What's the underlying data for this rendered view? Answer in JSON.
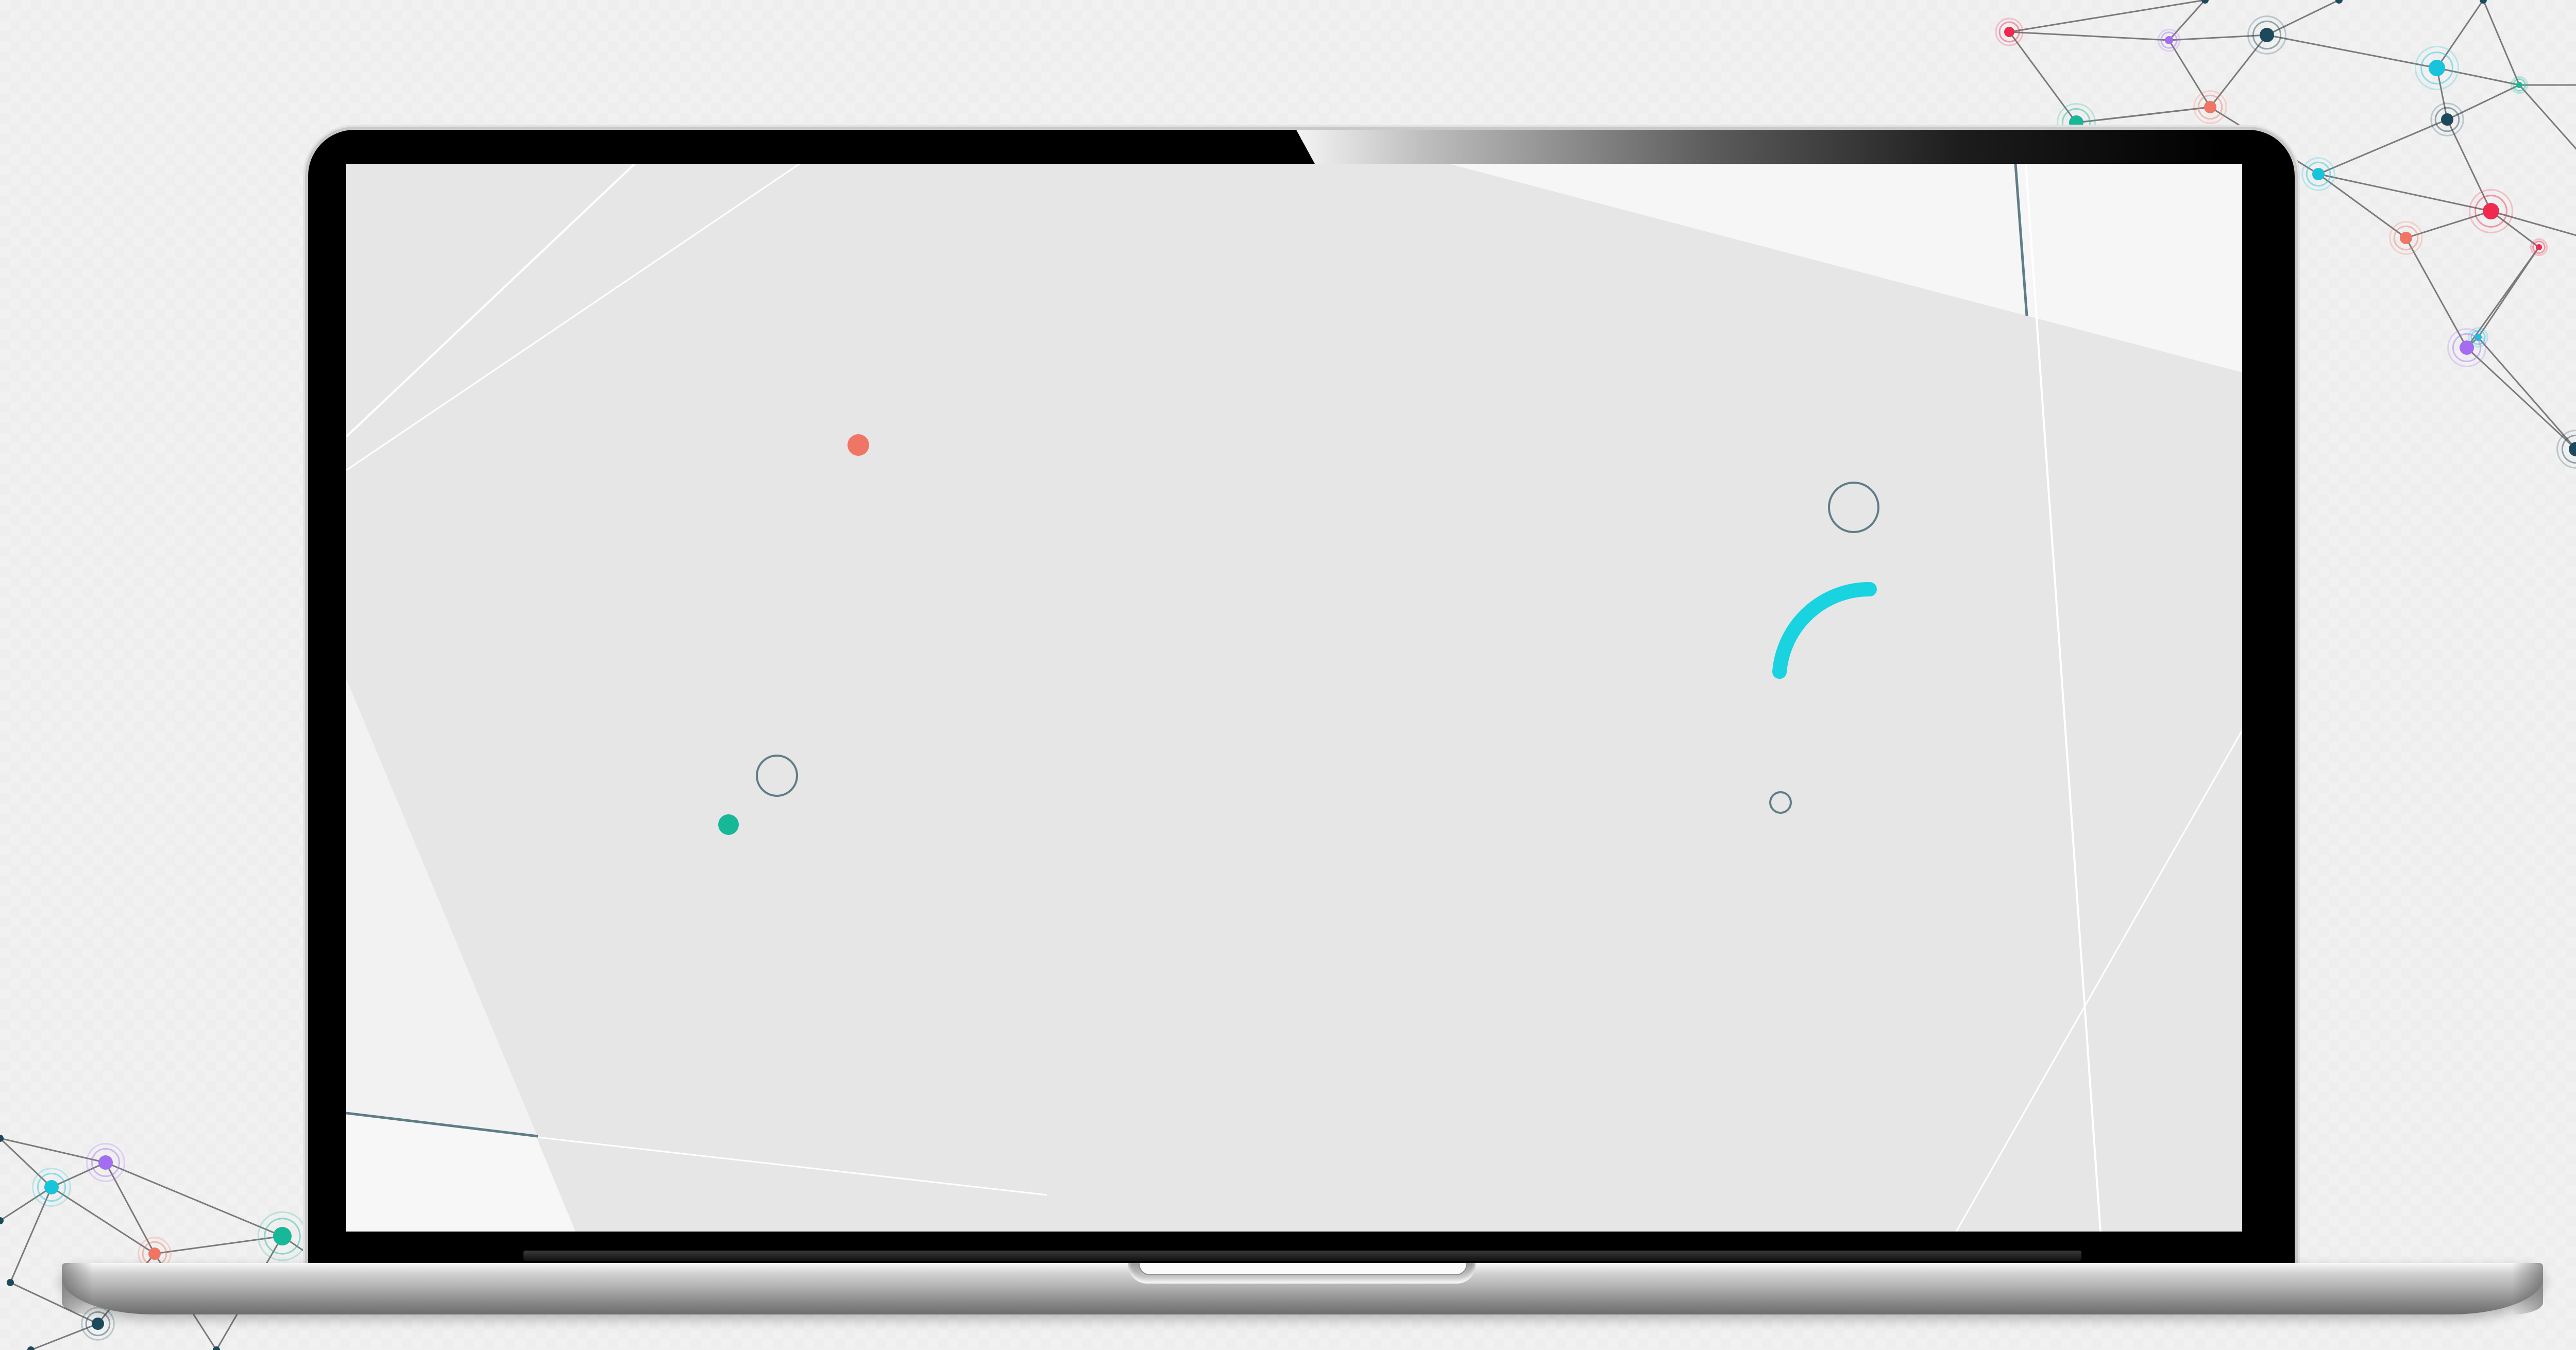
{
  "scene": {
    "device": "laptop",
    "colors": {
      "page_background": "#f1f1f1",
      "bezel": "#000000",
      "screen_panel": "#e6e6e6",
      "screen_light_facet": "#f5f5f5",
      "accent_cyan": "#19d3e0",
      "accent_teal": "#17b897",
      "accent_coral": "#f07565",
      "outline_slate": "#5e7d86",
      "network_line": "#7a7a7a",
      "network_node_colors": [
        "#f02a4e",
        "#17c4dc",
        "#17b897",
        "#1c4a5c",
        "#a46cf0",
        "#f07565"
      ]
    },
    "screen_shapes": [
      {
        "shape": "dot",
        "color": "#f07565"
      },
      {
        "shape": "ring",
        "color": "#5e7d86"
      },
      {
        "shape": "dot",
        "color": "#17b897"
      },
      {
        "shape": "ring",
        "color": "#5e7d86"
      },
      {
        "shape": "arc",
        "color": "#19d3e0"
      },
      {
        "shape": "ring",
        "color": "#5e7d86"
      }
    ]
  }
}
